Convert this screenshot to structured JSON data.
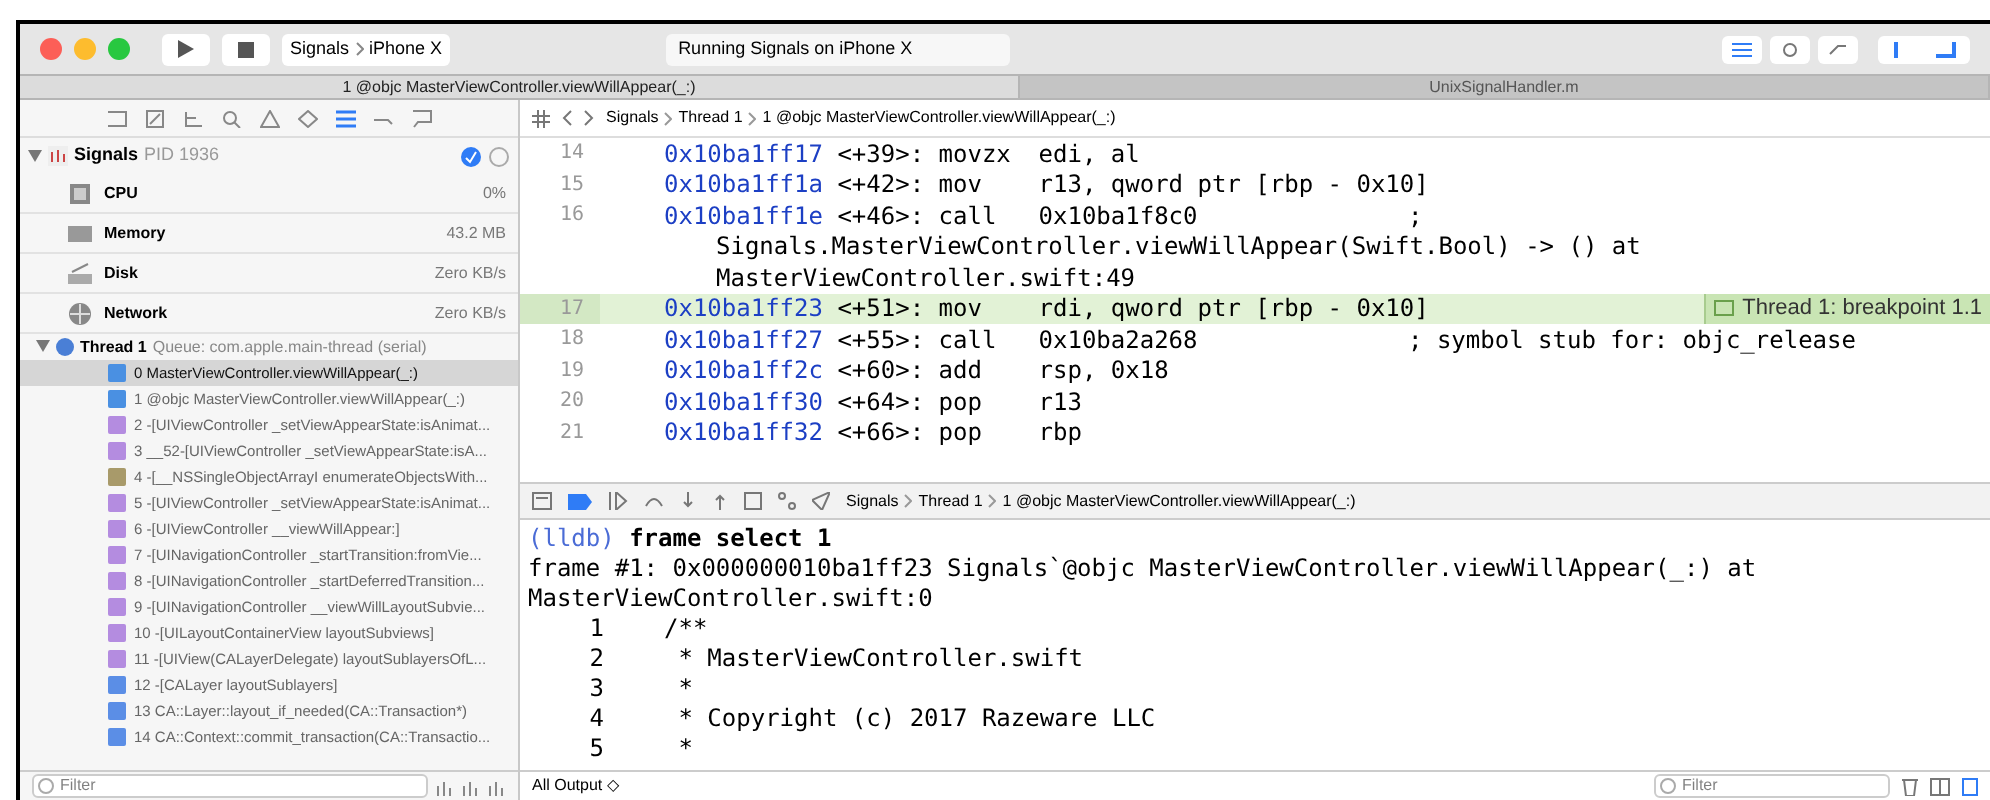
{
  "toolbar": {
    "scheme": "Signals",
    "device": "iPhone X",
    "activity": "Running Signals on iPhone X"
  },
  "tabs": [
    {
      "label": "1 @objc MasterViewController.viewWillAppear(_:)",
      "selected": true
    },
    {
      "label": "UnixSignalHandler.m",
      "selected": false
    }
  ],
  "navigator": {
    "process": {
      "name": "Signals",
      "pid": "PID 1936"
    },
    "gauges": [
      {
        "kind": "cpu",
        "label": "CPU",
        "value": "0%"
      },
      {
        "kind": "memory",
        "label": "Memory",
        "value": "43.2 MB"
      },
      {
        "kind": "disk",
        "label": "Disk",
        "value": "Zero KB/s"
      },
      {
        "kind": "network",
        "label": "Network",
        "value": "Zero KB/s"
      }
    ],
    "thread": {
      "name": "Thread 1",
      "queue": "Queue: com.apple.main-thread (serial)",
      "expanded": true
    },
    "frames": [
      {
        "text": "0 MasterViewController.viewWillAppear(_:)",
        "color": "#4a90e2",
        "selected": true
      },
      {
        "text": "1 @objc MasterViewController.viewWillAppear(_:)",
        "color": "#4a90e2",
        "selected": false
      },
      {
        "text": "2 -[UIViewController _setViewAppearState:isAnimat...",
        "color": "#b48ce0",
        "selected": false
      },
      {
        "text": "3 __52-[UIViewController _setViewAppearState:isA...",
        "color": "#b48ce0",
        "selected": false
      },
      {
        "text": "4 -[__NSSingleObjectArrayI enumerateObjectsWith...",
        "color": "#a89a6a",
        "selected": false
      },
      {
        "text": "5 -[UIViewController _setViewAppearState:isAnimat...",
        "color": "#b48ce0",
        "selected": false
      },
      {
        "text": "6 -[UIViewController __viewWillAppear:]",
        "color": "#b48ce0",
        "selected": false
      },
      {
        "text": "7 -[UINavigationController _startTransition:fromVie...",
        "color": "#b48ce0",
        "selected": false
      },
      {
        "text": "8 -[UINavigationController _startDeferredTransition...",
        "color": "#b48ce0",
        "selected": false
      },
      {
        "text": "9 -[UINavigationController __viewWillLayoutSubvie...",
        "color": "#b48ce0",
        "selected": false
      },
      {
        "text": "10 -[UILayoutContainerView layoutSubviews]",
        "color": "#b48ce0",
        "selected": false
      },
      {
        "text": "11 -[UIView(CALayerDelegate) layoutSublayersOfL...",
        "color": "#b48ce0",
        "selected": false
      },
      {
        "text": "12 -[CALayer layoutSublayers]",
        "color": "#5b8ee6",
        "selected": false
      },
      {
        "text": "13 CA::Layer::layout_if_needed(CA::Transaction*)",
        "color": "#5b8ee6",
        "selected": false
      },
      {
        "text": "14 CA::Context::commit_transaction(CA::Transactio...",
        "color": "#5b8ee6",
        "selected": false
      }
    ],
    "filter": {
      "placeholder": "Filter"
    }
  },
  "editor": {
    "jump_bar": [
      "Signals",
      "Thread 1",
      "1 @objc MasterViewController.viewWillAppear(_:)"
    ],
    "lines": [
      {
        "kind": "instruction",
        "number": "14",
        "address": "0x10ba1ff17",
        "offset": "<+39>:",
        "mnemonic": "movzx",
        "operands": "edi, al",
        "current": false
      },
      {
        "kind": "instruction",
        "number": "15",
        "address": "0x10ba1ff1a",
        "offset": "<+42>:",
        "mnemonic": "mov",
        "operands": "r13, qword ptr [rbp - 0x10]",
        "current": false
      },
      {
        "kind": "instruction",
        "number": "16",
        "address": "0x10ba1ff1e",
        "offset": "<+46>:",
        "mnemonic": "call",
        "operands": "0x10ba1f8c0",
        "comment": ";",
        "current": false
      },
      {
        "kind": "continuation",
        "text": "Signals.MasterViewController.viewWillAppear(Swift.Bool) -> () at"
      },
      {
        "kind": "continuation",
        "text": "MasterViewController.swift:49"
      },
      {
        "kind": "instruction",
        "number": "17",
        "address": "0x10ba1ff23",
        "offset": "<+51>:",
        "mnemonic": "mov",
        "operands": "rdi, qword ptr [rbp - 0x10]",
        "current": true,
        "annotation": "Thread 1: breakpoint 1.1"
      },
      {
        "kind": "instruction",
        "number": "18",
        "address": "0x10ba1ff27",
        "offset": "<+55>:",
        "mnemonic": "call",
        "operands": "0x10ba2a268",
        "comment": "; symbol stub for: objc_release",
        "current": false
      },
      {
        "kind": "instruction",
        "number": "19",
        "address": "0x10ba1ff2c",
        "offset": "<+60>:",
        "mnemonic": "add",
        "operands": "rsp, 0x18",
        "current": false
      },
      {
        "kind": "instruction",
        "number": "20",
        "address": "0x10ba1ff30",
        "offset": "<+64>:",
        "mnemonic": "pop",
        "operands": "r13",
        "current": false
      },
      {
        "kind": "instruction",
        "number": "21",
        "address": "0x10ba1ff32",
        "offset": "<+66>:",
        "mnemonic": "pop",
        "operands": "rbp",
        "current": false
      }
    ]
  },
  "debug_bar": {
    "breakpoints_on": true,
    "path": [
      "Signals",
      "Thread 1",
      "1 @objc MasterViewController.viewWillAppear(_:)"
    ]
  },
  "console": {
    "prompt": "(lldb)",
    "command": "frame select 1",
    "output": [
      "frame #1: 0x000000010ba1ff23 Signals`@objc MasterViewController.viewWillAppear(_:) at",
      "MasterViewController.swift:0"
    ],
    "source": [
      {
        "number": "1",
        "text": "/**"
      },
      {
        "number": "2",
        "text": " * MasterViewController.swift"
      },
      {
        "number": "3",
        "text": " *"
      },
      {
        "number": "4",
        "text": " * Copyright (c) 2017 Razeware LLC"
      },
      {
        "number": "5",
        "text": " *"
      }
    ],
    "output_selector": "All Output ◇",
    "filter": {
      "placeholder": "Filter"
    }
  }
}
